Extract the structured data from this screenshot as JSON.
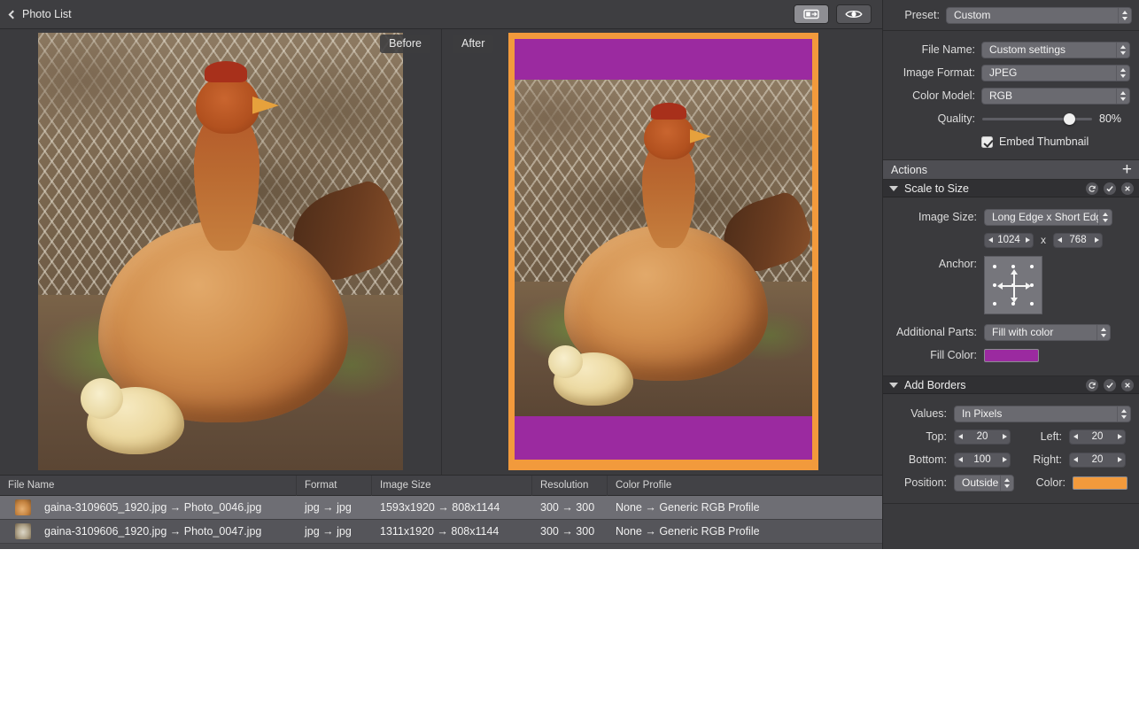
{
  "toolbar": {
    "back_label": "Photo List",
    "buttons": [
      {
        "name": "compare-view-button",
        "icon": "split-view-icon",
        "active": true
      },
      {
        "name": "preview-button",
        "icon": "eye-icon",
        "active": false
      }
    ]
  },
  "viewer": {
    "before_label": "Before",
    "after_label": "After"
  },
  "table": {
    "columns": [
      "File Name",
      "Format",
      "Image Size",
      "Resolution",
      "Color Profile"
    ],
    "rows": [
      {
        "file_name": "gaina-3109605_1920.jpg → Photo_0046.jpg",
        "format": "jpg → jpg",
        "image_size": "1593x1920 → 808x1144",
        "resolution": "300 → 300",
        "color_profile": "None → Generic RGB Profile",
        "selected": true
      },
      {
        "file_name": "gaina-3109606_1920.jpg → Photo_0047.jpg",
        "format": "jpg → jpg",
        "image_size": "1311x1920 → 808x1144",
        "resolution": "300 → 300",
        "color_profile": "None → Generic RGB Profile",
        "selected": false
      }
    ]
  },
  "inspector": {
    "preset": {
      "label": "Preset:",
      "value": "Custom"
    },
    "file_name": {
      "label": "File Name:",
      "value": "Custom settings"
    },
    "image_format": {
      "label": "Image Format:",
      "value": "JPEG"
    },
    "color_model": {
      "label": "Color Model:",
      "value": "RGB"
    },
    "quality": {
      "label": "Quality:",
      "value": "80%",
      "percent": 80
    },
    "embed_thumbnail": {
      "label": "Embed Thumbnail",
      "checked": true
    },
    "actions_title": "Actions",
    "add_action_icon": "plus-icon",
    "sections": [
      {
        "title": "Scale to Size",
        "image_size_label": "Image Size:",
        "image_size_mode": "Long Edge x Short Edge",
        "long_edge": "1024",
        "short_edge": "768",
        "dimension_separator": "x",
        "anchor_label": "Anchor:",
        "additional_parts_label": "Additional Parts:",
        "additional_parts_value": "Fill with color",
        "fill_color_label": "Fill Color:",
        "fill_color": "#9B2AA0"
      },
      {
        "title": "Add Borders",
        "values_label": "Values:",
        "values_mode": "In Pixels",
        "top_label": "Top:",
        "top": "20",
        "left_label": "Left:",
        "left": "20",
        "bottom_label": "Bottom:",
        "bottom": "100",
        "right_label": "Right:",
        "right": "20",
        "position_label": "Position:",
        "position": "Outside",
        "color_label": "Color:",
        "border_color": "#F29A3C"
      }
    ],
    "section_icons": [
      "reset-icon",
      "enable-check-icon",
      "remove-icon"
    ]
  }
}
